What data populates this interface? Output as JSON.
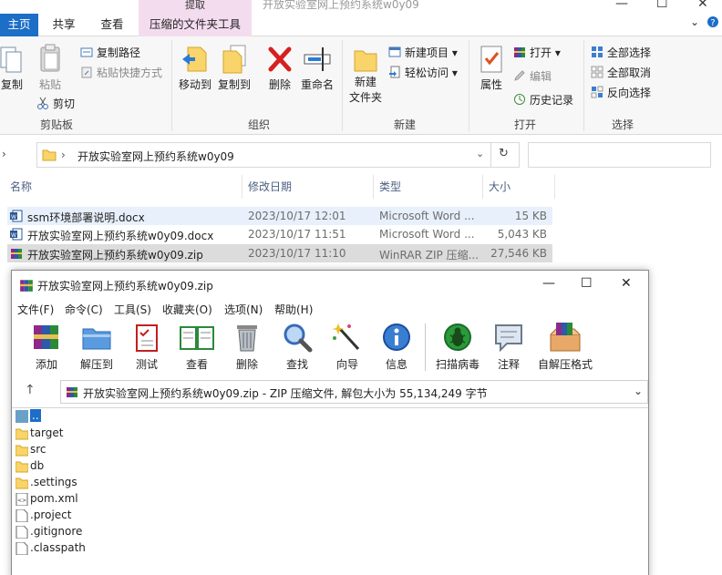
{
  "explorer": {
    "context_tab_label": "提取",
    "window_title": "开放实验室网上预约系统w0y09",
    "tabs": [
      "主页",
      "共享",
      "查看",
      "压缩的文件夹工具"
    ],
    "ribbon": {
      "clipboard": {
        "label": "剪贴板",
        "copy": "复制",
        "paste": "粘贴",
        "copy_path": "复制路径",
        "paste_shortcut": "粘贴快捷方式",
        "cut": "剪切"
      },
      "organize": {
        "label": "组织",
        "move_to": "移动到",
        "copy_to": "复制到",
        "delete": "删除",
        "rename": "重命名"
      },
      "new": {
        "label": "新建",
        "new_folder": "新建\n文件夹",
        "new_item": "新建项目",
        "easy_access": "轻松访问"
      },
      "open": {
        "label": "打开",
        "properties": "属性",
        "open": "打开",
        "edit": "编辑",
        "history": "历史记录"
      },
      "select": {
        "label": "选择",
        "select_all": "全部选择",
        "select_none": "全部取消",
        "invert": "反向选择"
      }
    },
    "address": {
      "path": "开放实验室网上预约系统w0y09"
    },
    "columns": [
      "名称",
      "修改日期",
      "类型",
      "大小"
    ],
    "files": [
      {
        "name": "ssm环境部署说明.docx",
        "date": "2023/10/17 12:01",
        "type": "Microsoft Word ...",
        "size": "15 KB",
        "icon": "word-icon"
      },
      {
        "name": "开放实验室网上预约系统w0y09.docx",
        "date": "2023/10/17 11:51",
        "type": "Microsoft Word ...",
        "size": "5,043 KB",
        "icon": "word-icon"
      },
      {
        "name": "开放实验室网上预约系统w0y09.zip",
        "date": "2023/10/17 11:10",
        "type": "WinRAR ZIP 压缩...",
        "size": "27,546 KB",
        "icon": "winrar-icon"
      }
    ]
  },
  "winrar": {
    "title": "开放实验室网上预约系统w0y09.zip",
    "menu": [
      "文件(F)",
      "命令(C)",
      "工具(S)",
      "收藏夹(O)",
      "选项(N)",
      "帮助(H)"
    ],
    "tools": [
      "添加",
      "解压到",
      "测试",
      "查看",
      "删除",
      "查找",
      "向导",
      "信息",
      "扫描病毒",
      "注释",
      "自解压格式"
    ],
    "path_text": "开放实验室网上预约系统w0y09.zip - ZIP 压缩文件, 解包大小为 55,134,249 字节",
    "items": [
      {
        "name": "..",
        "icon": "up-folder-icon"
      },
      {
        "name": "target",
        "icon": "folder-icon"
      },
      {
        "name": "src",
        "icon": "folder-icon"
      },
      {
        "name": "db",
        "icon": "folder-icon"
      },
      {
        "name": ".settings",
        "icon": "folder-icon"
      },
      {
        "name": "pom.xml",
        "icon": "xml-file-icon"
      },
      {
        "name": ".project",
        "icon": "file-icon"
      },
      {
        "name": ".gitignore",
        "icon": "file-icon"
      },
      {
        "name": ".classpath",
        "icon": "file-icon"
      }
    ]
  },
  "colors": {
    "accent": "#1c6ec7",
    "context_tab": "#f4dcef",
    "ribbon_bg": "#f7f7f7",
    "selected_row": "#dcdcdc",
    "hover_row": "#e7f0fb"
  }
}
